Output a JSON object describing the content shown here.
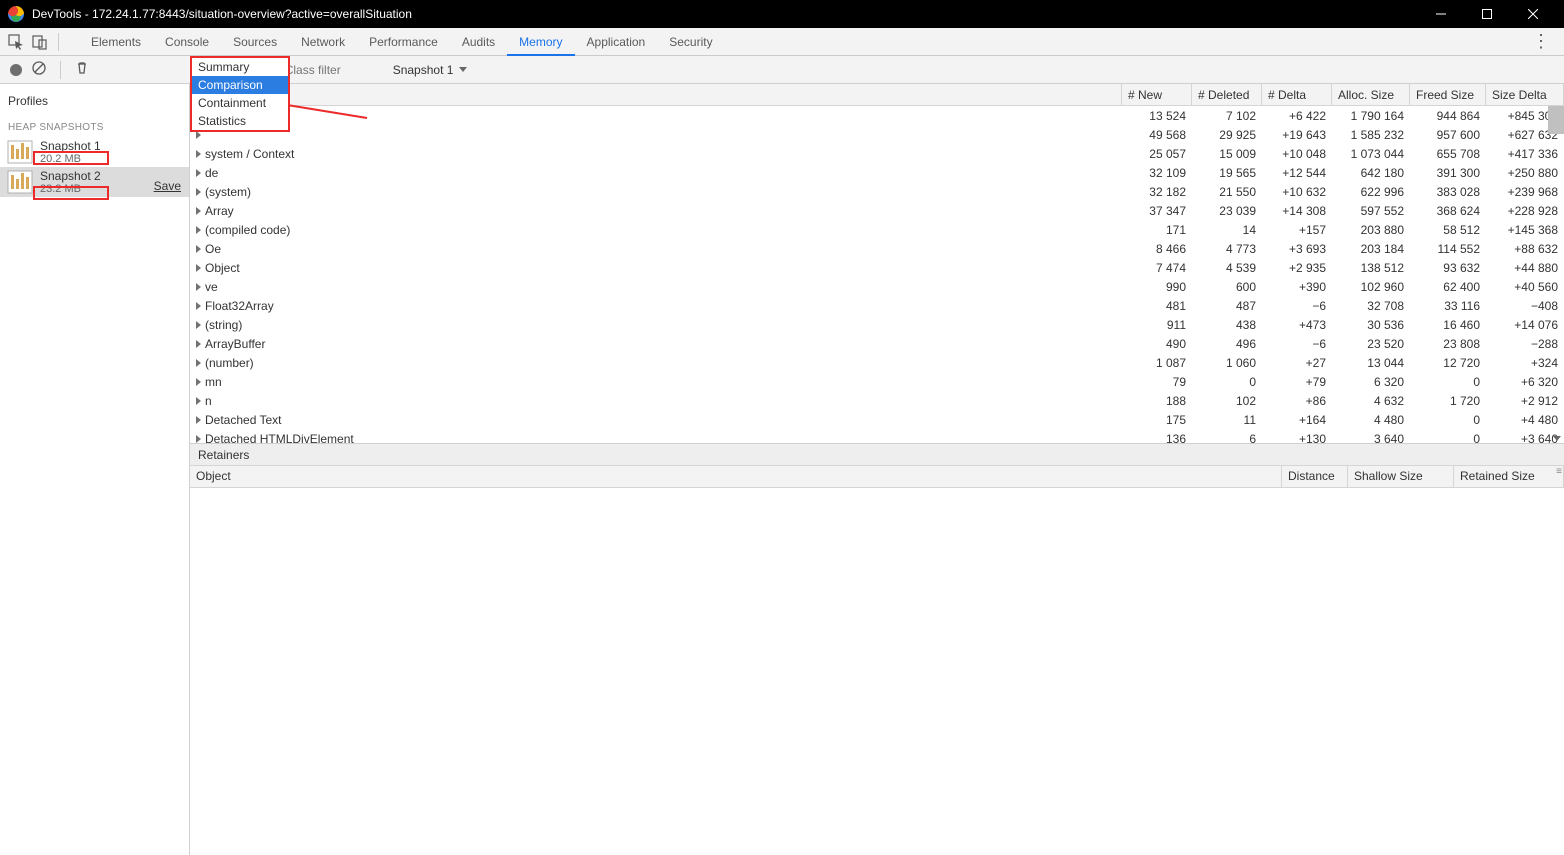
{
  "titlebar": {
    "text": "DevTools - 172.24.1.77:8443/situation-overview?active=overallSituation"
  },
  "tabs": [
    "Elements",
    "Console",
    "Sources",
    "Network",
    "Performance",
    "Audits",
    "Memory",
    "Application",
    "Security"
  ],
  "active_tab": "Memory",
  "subbar": {
    "view": "Comparison",
    "class_filter_placeholder": "Class filter",
    "baseline": "Snapshot 1"
  },
  "sidebar": {
    "header": "Profiles",
    "section": "HEAP SNAPSHOTS",
    "snapshots": [
      {
        "name": "Snapshot 1",
        "size": "20.2 MB"
      },
      {
        "name": "Snapshot 2",
        "size": "23.2 MB"
      }
    ],
    "save": "Save"
  },
  "dropdown": {
    "items": [
      "Summary",
      "Comparison",
      "Containment",
      "Statistics"
    ],
    "selected": "Comparison"
  },
  "columns": [
    "# New",
    "# Deleted",
    "# Delta",
    "Alloc. Size",
    "Freed Size",
    "Size Delta"
  ],
  "rows": [
    {
      "c": "",
      "n": "13 524",
      "d": "7 102",
      "dl": "+6 422",
      "a": "1 790 164",
      "f": "944 864",
      "sd": "+845 300"
    },
    {
      "c": "",
      "n": "49 568",
      "d": "29 925",
      "dl": "+19 643",
      "a": "1 585 232",
      "f": "957 600",
      "sd": "+627 632"
    },
    {
      "c": "system / Context",
      "n": "25 057",
      "d": "15 009",
      "dl": "+10 048",
      "a": "1 073 044",
      "f": "655 708",
      "sd": "+417 336"
    },
    {
      "c": "de",
      "n": "32 109",
      "d": "19 565",
      "dl": "+12 544",
      "a": "642 180",
      "f": "391 300",
      "sd": "+250 880"
    },
    {
      "c": "(system)",
      "n": "32 182",
      "d": "21 550",
      "dl": "+10 632",
      "a": "622 996",
      "f": "383 028",
      "sd": "+239 968"
    },
    {
      "c": "Array",
      "n": "37 347",
      "d": "23 039",
      "dl": "+14 308",
      "a": "597 552",
      "f": "368 624",
      "sd": "+228 928"
    },
    {
      "c": "(compiled code)",
      "n": "171",
      "d": "14",
      "dl": "+157",
      "a": "203 880",
      "f": "58 512",
      "sd": "+145 368"
    },
    {
      "c": "Oe",
      "n": "8 466",
      "d": "4 773",
      "dl": "+3 693",
      "a": "203 184",
      "f": "114 552",
      "sd": "+88 632"
    },
    {
      "c": "Object",
      "n": "7 474",
      "d": "4 539",
      "dl": "+2 935",
      "a": "138 512",
      "f": "93 632",
      "sd": "+44 880"
    },
    {
      "c": "ve",
      "n": "990",
      "d": "600",
      "dl": "+390",
      "a": "102 960",
      "f": "62 400",
      "sd": "+40 560"
    },
    {
      "c": "Float32Array",
      "n": "481",
      "d": "487",
      "dl": "−6",
      "a": "32 708",
      "f": "33 116",
      "sd": "−408"
    },
    {
      "c": "(string)",
      "n": "911",
      "d": "438",
      "dl": "+473",
      "a": "30 536",
      "f": "16 460",
      "sd": "+14 076"
    },
    {
      "c": "ArrayBuffer",
      "n": "490",
      "d": "496",
      "dl": "−6",
      "a": "23 520",
      "f": "23 808",
      "sd": "−288"
    },
    {
      "c": "(number)",
      "n": "1 087",
      "d": "1 060",
      "dl": "+27",
      "a": "13 044",
      "f": "12 720",
      "sd": "+324"
    },
    {
      "c": "mn",
      "n": "79",
      "d": "0",
      "dl": "+79",
      "a": "6 320",
      "f": "0",
      "sd": "+6 320"
    },
    {
      "c": "n",
      "n": "188",
      "d": "102",
      "dl": "+86",
      "a": "4 632",
      "f": "1 720",
      "sd": "+2 912"
    },
    {
      "c": "Detached Text",
      "n": "175",
      "d": "11",
      "dl": "+164",
      "a": "4 480",
      "f": "0",
      "sd": "+4 480"
    },
    {
      "c": "Detached HTMLDivElement",
      "n": "136",
      "d": "6",
      "dl": "+130",
      "a": "3 640",
      "f": "0",
      "sd": "+3 640"
    }
  ],
  "retainers": {
    "title": "Retainers",
    "cols": [
      "Object",
      "Distance",
      "Shallow Size",
      "Retained Size"
    ]
  }
}
